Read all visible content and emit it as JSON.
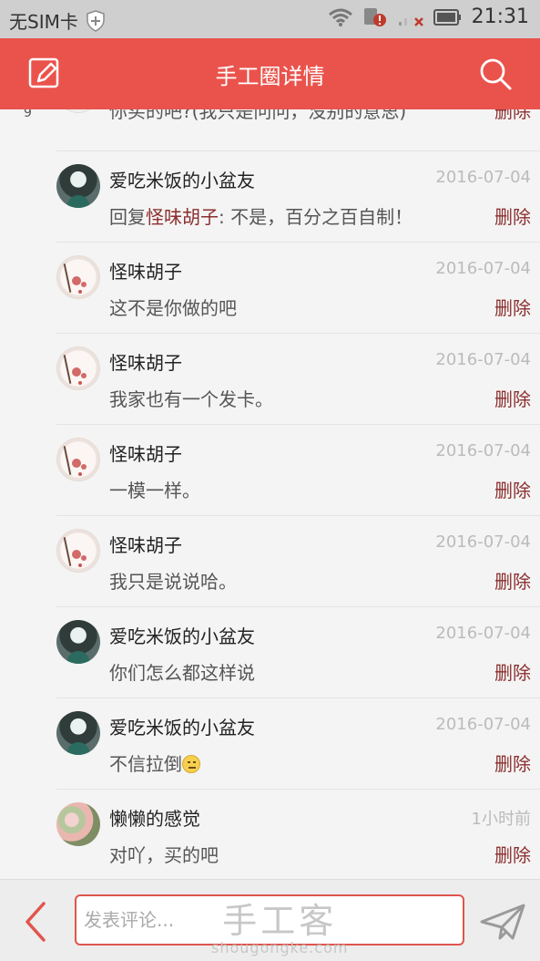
{
  "status_bar": {
    "carrier": "无SIM卡",
    "time": "21:31"
  },
  "header": {
    "title": "手工圈详情"
  },
  "side_number": "9",
  "partial_comment": {
    "text": "你买的吧?(我只是问问，没别的意思)",
    "delete_label": "删除"
  },
  "comments": [
    {
      "user": "爱吃米饭的小盆友",
      "date": "2016-07-04",
      "reply_prefix": "回复",
      "mention": "怪味胡子",
      "text": ": 不是，百分之百自制！",
      "delete_label": "删除",
      "avatar": "girl-avatar"
    },
    {
      "user": "怪味胡子",
      "date": "2016-07-04",
      "text": "这不是你做的吧",
      "delete_label": "删除",
      "avatar": "plum-blossom-avatar"
    },
    {
      "user": "怪味胡子",
      "date": "2016-07-04",
      "text": "我家也有一个发卡。",
      "delete_label": "删除",
      "avatar": "plum-blossom-avatar"
    },
    {
      "user": "怪味胡子",
      "date": "2016-07-04",
      "text": "一模一样。",
      "delete_label": "删除",
      "avatar": "plum-blossom-avatar"
    },
    {
      "user": "怪味胡子",
      "date": "2016-07-04",
      "text": "我只是说说哈。",
      "delete_label": "删除",
      "avatar": "plum-blossom-avatar"
    },
    {
      "user": "爱吃米饭的小盆友",
      "date": "2016-07-04",
      "text": "你们怎么都这样说",
      "delete_label": "删除",
      "avatar": "girl-avatar"
    },
    {
      "user": "爱吃米饭的小盆友",
      "date": "2016-07-04",
      "text": "不信拉倒",
      "delete_label": "删除",
      "avatar": "girl-avatar"
    },
    {
      "user": "懒懒的感觉",
      "date": "1小时前",
      "text": "对吖，买的吧",
      "delete_label": "删除",
      "avatar": "flower-avatar"
    }
  ],
  "bottom_bar": {
    "input_placeholder": "发表评论...",
    "watermark_main": "手工客",
    "watermark_sub": "shougongke.com"
  },
  "colors": {
    "accent": "#ea534c",
    "delete": "#8c2e2e"
  }
}
